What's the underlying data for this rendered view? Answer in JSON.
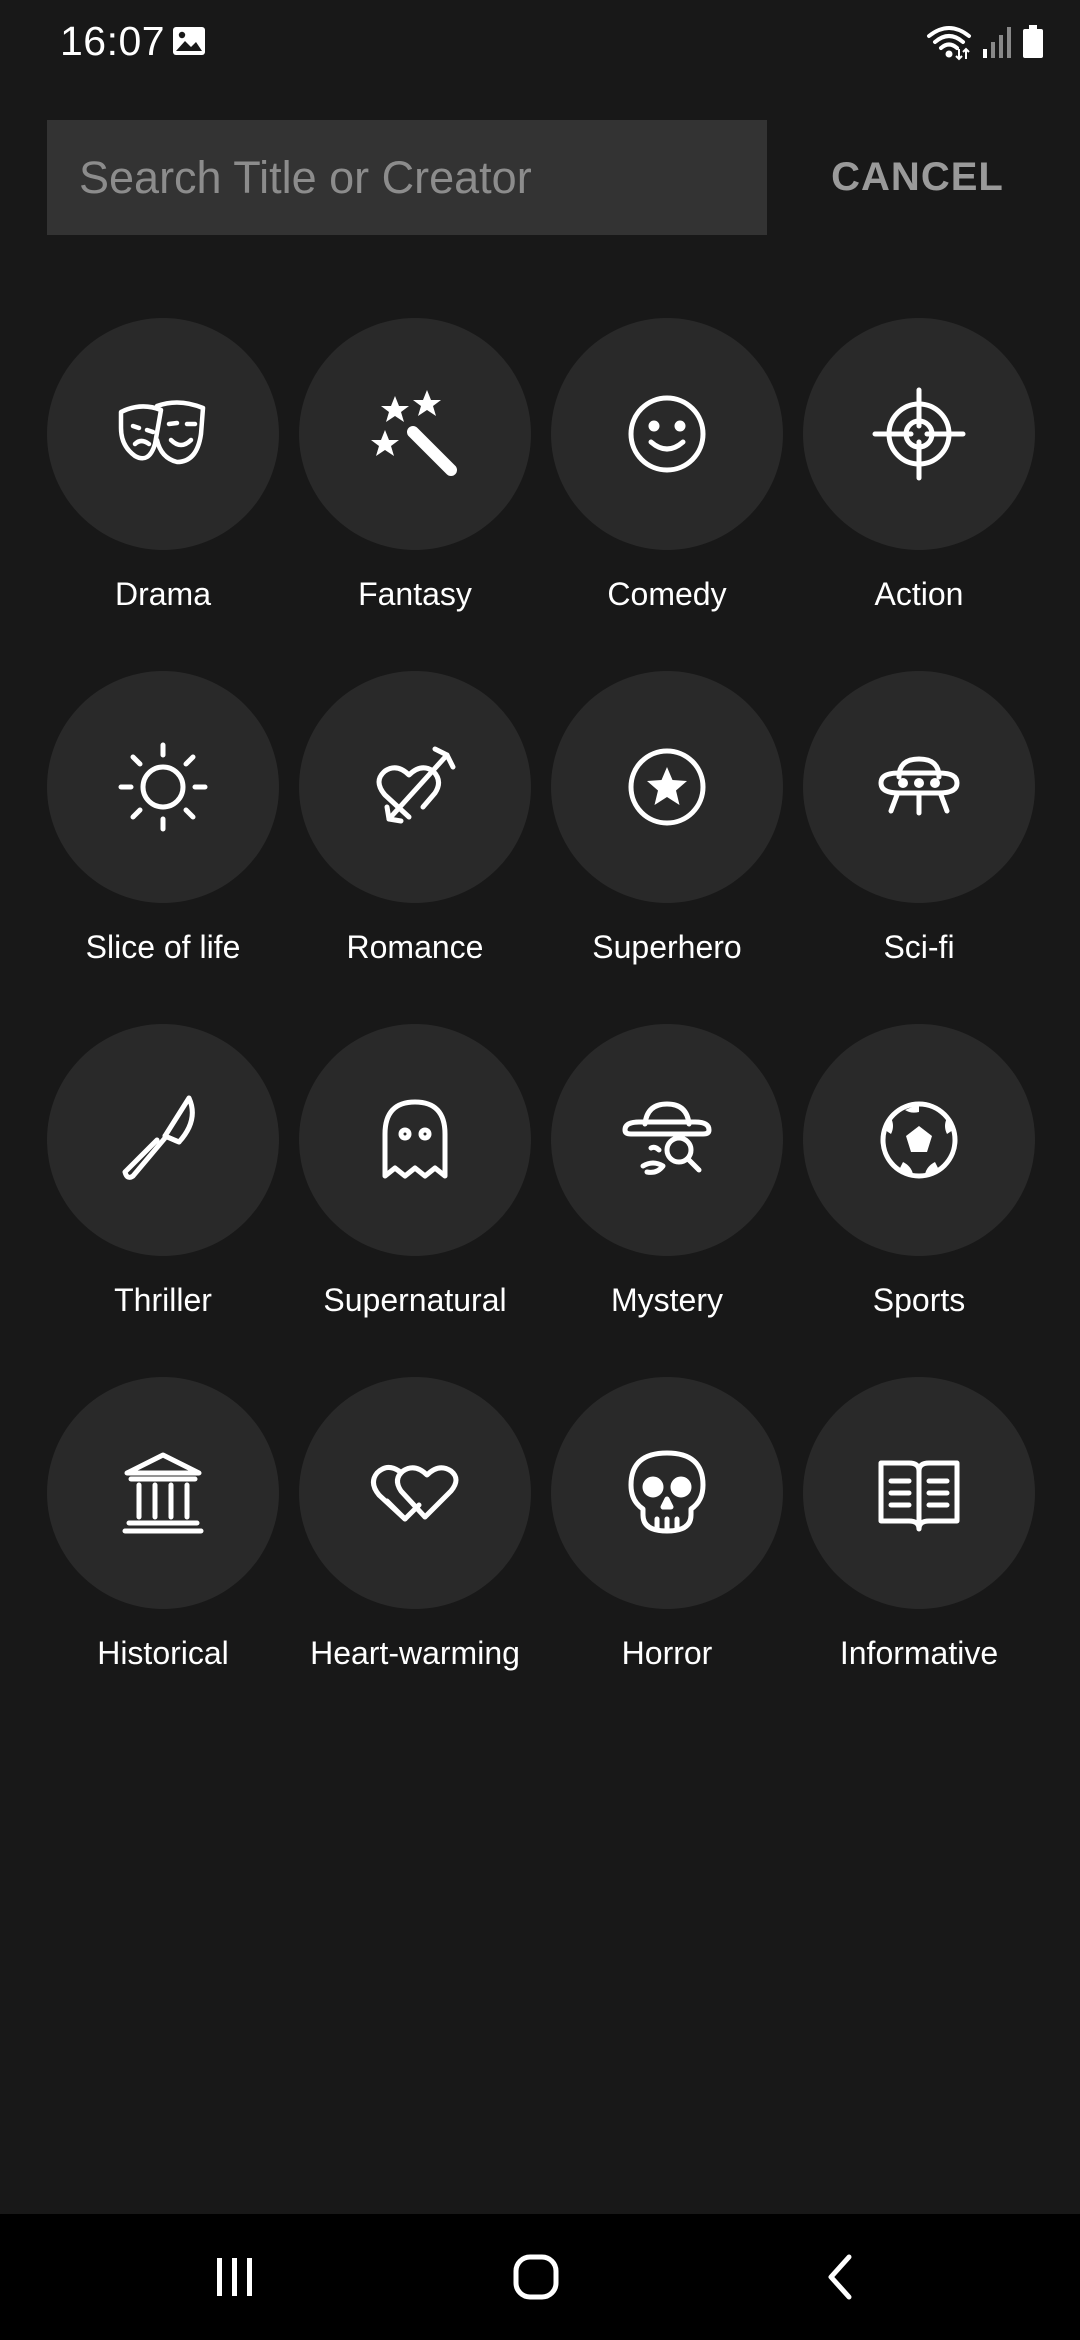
{
  "status_bar": {
    "time": "16:07"
  },
  "search": {
    "placeholder": "Search Title or Creator",
    "value": "",
    "cancel_label": "CANCEL"
  },
  "genres": [
    {
      "label": "Drama",
      "icon": "drama-masks-icon"
    },
    {
      "label": "Fantasy",
      "icon": "magic-wand-icon"
    },
    {
      "label": "Comedy",
      "icon": "smiley-face-icon"
    },
    {
      "label": "Action",
      "icon": "crosshair-icon"
    },
    {
      "label": "Slice of life",
      "icon": "sun-icon"
    },
    {
      "label": "Romance",
      "icon": "heart-arrow-icon"
    },
    {
      "label": "Superhero",
      "icon": "star-circle-icon"
    },
    {
      "label": "Sci-fi",
      "icon": "ufo-icon"
    },
    {
      "label": "Thriller",
      "icon": "knife-icon"
    },
    {
      "label": "Supernatural",
      "icon": "ghost-icon"
    },
    {
      "label": "Mystery",
      "icon": "detective-icon"
    },
    {
      "label": "Sports",
      "icon": "soccer-ball-icon"
    },
    {
      "label": "Historical",
      "icon": "pillared-building-icon"
    },
    {
      "label": "Heart-warming",
      "icon": "two-hearts-icon"
    },
    {
      "label": "Horror",
      "icon": "skull-icon"
    },
    {
      "label": "Informative",
      "icon": "open-book-icon"
    }
  ],
  "nav_bar": {
    "recents": "recent-apps-icon",
    "home": "home-icon",
    "back": "back-icon"
  },
  "colors": {
    "background": "#181818",
    "search_box": "#333333",
    "genre_circle": "#292929",
    "cancel_text": "#9a9a9a",
    "nav_bar": "#000000"
  }
}
